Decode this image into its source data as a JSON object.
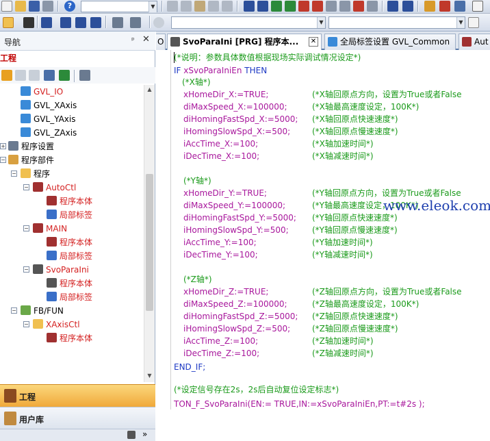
{
  "toolbar": {
    "combo1_value": "",
    "combo2_value": "",
    "combo3_value": "",
    "help_icon": "help-icon"
  },
  "navigator": {
    "title": "导航",
    "pin": "ᵖ",
    "close": "✕",
    "project_label": "工程",
    "tree": {
      "gvl_io": "GVL_IO",
      "gvl_xaxis": "GVL_XAxis",
      "gvl_yaxis": "GVL_YAxis",
      "gvl_zaxis": "GVL_ZAxis",
      "program_settings": "程序设置",
      "program_parts": "程序部件",
      "program": "程序",
      "autoctl": "AutoCtl",
      "program_body": "程序本体",
      "local_tags": "局部标签",
      "main": "MAIN",
      "svoparaini": "SvoParaIni",
      "fbfun": "FB/FUN",
      "xaxisctl": "XAxisCtl"
    },
    "project_button": "工程",
    "library_button": "用户库",
    "footer_arrows": "»"
  },
  "tabs": [
    {
      "label": "O"
    },
    {
      "label": "SvoParaIni [PRG] 程序本..."
    },
    {
      "label": "全局标签设置 GVL_Common"
    },
    {
      "label": "Aut"
    }
  ],
  "code": {
    "l1": "(*说明：参数具体数值根据现场实际调试情况设定*)",
    "l2_kw": "IF",
    "l2_var": "xSvoParaIniEn",
    "l2_kw2": "THEN",
    "l3": "(*X轴*)",
    "l4_code": "xHomeDir_X:=TRUE;",
    "l4_cm": "(*X轴回原点方向，设置为True或者False",
    "l5_code": "diMaxSpeed_X:=100000;",
    "l5_cm": "(*X轴最高速度设定，100K*)",
    "l6_code": "diHomingFastSpd_X:=5000;",
    "l6_cm": "(*X轴回原点快速速度*)",
    "l7_code": "iHomingSlowSpd_X:=500;",
    "l7_cm": "(*X轴回原点慢速速度*)",
    "l8_code": "iAccTime_X:=100;",
    "l8_cm": "(*X轴加速时间*)",
    "l9_code": "iDecTime_X:=100;",
    "l9_cm": "(*X轴减速时间*)",
    "l10": "(*Y轴*)",
    "l11_code": "xHomeDir_Y:=TRUE;",
    "l11_cm": "(*Y轴回原点方向，设置为True或者False",
    "l12_code": "diMaxSpeed_Y:=100000;",
    "l12_cm": "(*Y轴最高速度设定，100K*)",
    "l13_code": "diHomingFastSpd_Y:=5000;",
    "l13_cm": "(*Y轴回原点快速速度*)",
    "l14_code": "iHomingSlowSpd_Y:=500;",
    "l14_cm": "(*Y轴回原点慢速速度*)",
    "l15_code": "iAccTime_Y:=100;",
    "l15_cm": "(*Y轴加速时间*)",
    "l16_code": "iDecTime_Y:=100;",
    "l16_cm": "(*Y轴减速时间*)",
    "l17": "(*Z轴*)",
    "l18_code": "xHomeDir_Z:=TRUE;",
    "l18_cm": "(*Z轴回原点方向，设置为True或者False",
    "l19_code": "diMaxSpeed_Z:=100000;",
    "l19_cm": "(*Z轴最高速度设定，100K*)",
    "l20_code": "diHomingFastSpd_Z:=5000;",
    "l20_cm": "(*Z轴回原点快速速度*)",
    "l21_code": "iHomingSlowSpd_Z:=500;",
    "l21_cm": "(*Z轴回原点慢速速度*)",
    "l22_code": "iAccTime_Z:=100;",
    "l22_cm": "(*Z轴加速时间*)",
    "l23_code": "iDecTime_Z:=100;",
    "l23_cm": "(*Z轴减速时间*)",
    "l24": "END_IF;",
    "l25": "(*设定信号存在2s，2s后自动复位设定标志*)",
    "l26": "TON_F_SvoParaIni(EN:= TRUE,IN:=xSvoParaIniEn,PT:=t#2s );"
  },
  "watermark": "www.eleok.com",
  "colors": {
    "comment": "#1a9a1a",
    "keyword": "#1d39c4",
    "variable": "#a8179c",
    "tree_red": "#d42020",
    "project_button": "#f0a93a"
  }
}
